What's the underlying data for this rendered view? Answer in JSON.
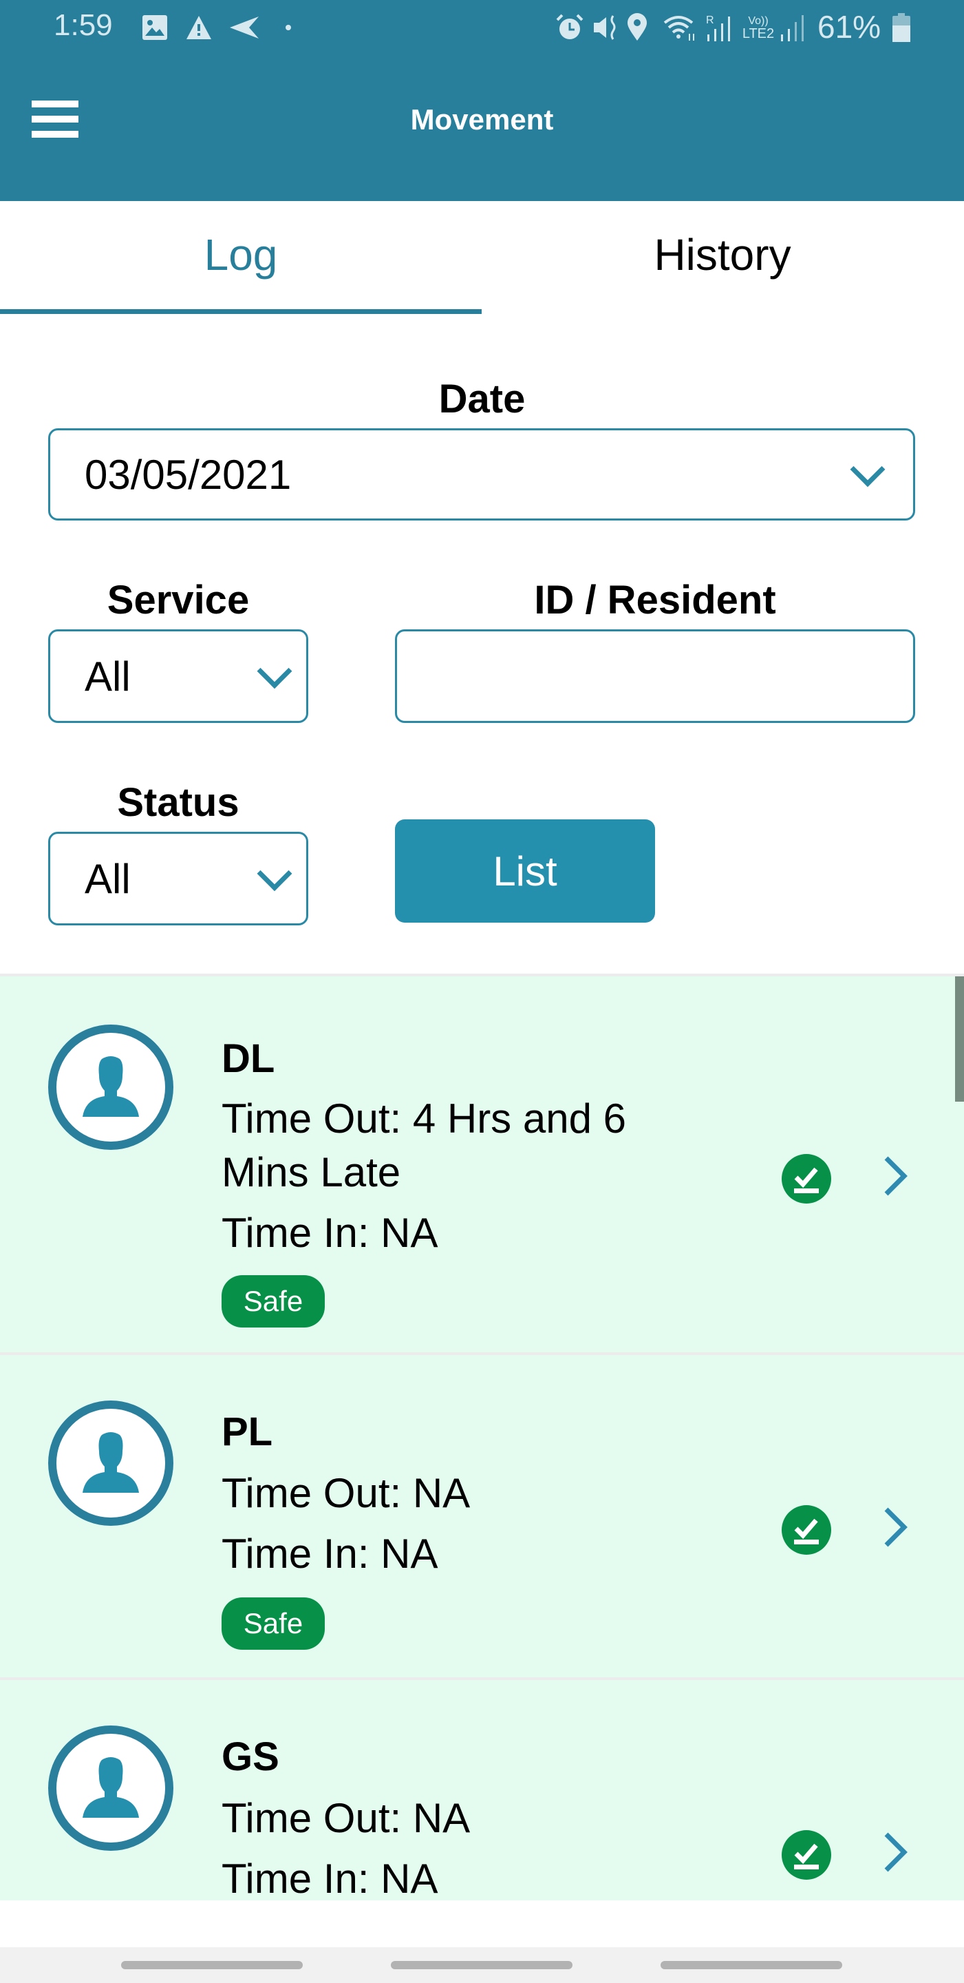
{
  "status_bar": {
    "time": "1:59",
    "left_icons": [
      "image-icon",
      "warning-icon",
      "send-icon",
      "dot-icon"
    ],
    "right_icons": [
      "alarm-icon",
      "vibrate-icon",
      "location-icon",
      "wifi-icon",
      "signal-r-icon",
      "volte-lte2-icon",
      "signal-icon"
    ],
    "volte_label": "Vo))",
    "lte_label": "LTE2",
    "roaming_label": "R",
    "battery_percent": "61%"
  },
  "app_bar": {
    "title": "Movement",
    "menu_icon": "hamburger-icon"
  },
  "tabs": [
    {
      "label": "Log",
      "active": true
    },
    {
      "label": "History",
      "active": false
    }
  ],
  "form": {
    "date": {
      "label": "Date",
      "value": "03/05/2021"
    },
    "service": {
      "label": "Service",
      "value": "All"
    },
    "resident": {
      "label": "ID / Resident",
      "value": "",
      "placeholder": ""
    },
    "status": {
      "label": "Status",
      "value": "All"
    },
    "list_button": "List"
  },
  "residents": [
    {
      "initials": "DL",
      "time_out": "Time Out: 4 Hrs and 6 Mins Late",
      "time_in": "Time In: NA",
      "badge": "Safe"
    },
    {
      "initials": "PL",
      "time_out": "Time Out: NA",
      "time_in": "Time In: NA",
      "badge": "Safe"
    },
    {
      "initials": "GS",
      "time_out": "Time Out: NA",
      "time_in": "Time In: NA",
      "badge": ""
    }
  ],
  "colors": {
    "primary": "#287f9b",
    "button": "#2590ae",
    "safe_green": "#079048",
    "list_bg": "#e4fcf0"
  }
}
